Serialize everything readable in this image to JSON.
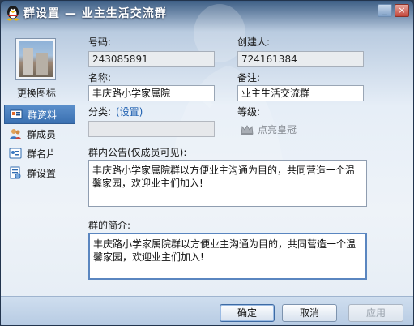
{
  "window": {
    "title": "群设置 — 业主生活交流群"
  },
  "sidebar": {
    "change_icon_label": "更换图标",
    "items": [
      {
        "label": "群资料",
        "active": true
      },
      {
        "label": "群成员",
        "active": false
      },
      {
        "label": "群名片",
        "active": false
      },
      {
        "label": "群设置",
        "active": false
      }
    ]
  },
  "form": {
    "number_label": "号码:",
    "number_value": "243085891",
    "creator_label": "创建人:",
    "creator_value": "724161384",
    "name_label": "名称:",
    "name_value": "丰庆路小学家属院",
    "note_label": "备注:",
    "note_value": "业主生活交流群",
    "category_label": "分类:",
    "category_link": "(设置)",
    "category_value": "",
    "level_label": "等级:",
    "crown_link": "点亮皇冠",
    "announcement_label": "群内公告(仅成员可见):",
    "announcement_text": "丰庆路小学家属院群以方便业主沟通为目的，共同营造一个温馨家园，欢迎业主们加入!",
    "intro_label": "群的简介:",
    "intro_text": "丰庆路小学家属院群以方便业主沟通为目的，共同营造一个温馨家园，欢迎业主们加入!"
  },
  "buttons": {
    "ok": "确定",
    "cancel": "取消",
    "apply": "应用"
  },
  "titlebar_buttons": {
    "minimize": "_",
    "close": "×"
  }
}
